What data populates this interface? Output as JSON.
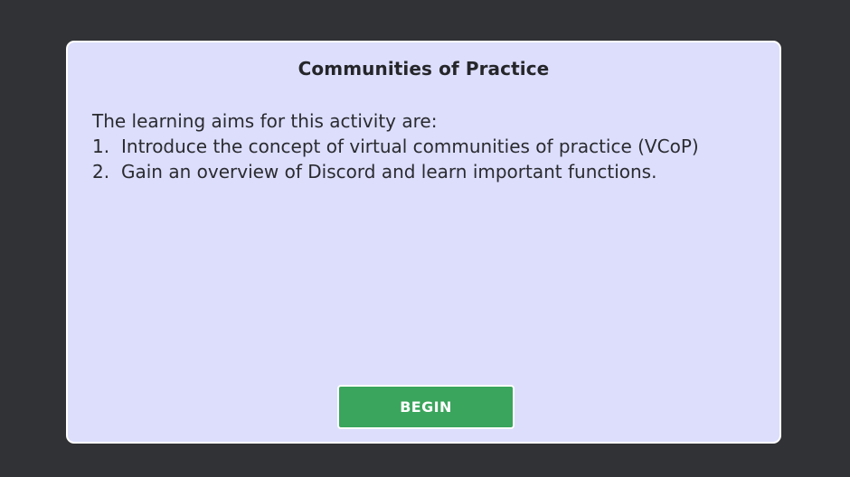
{
  "dialog": {
    "title": "Communities of Practice",
    "intro": "The learning aims for this activity are:",
    "aims": [
      {
        "number": "1.",
        "text": "Introduce the concept of virtual communities of practice (VCoP)"
      },
      {
        "number": "2.",
        "text": "Gain an overview of Discord and learn important functions."
      }
    ],
    "begin_label": "BEGIN"
  },
  "colors": {
    "background": "#313235",
    "dialog_fill": "#dcdefc",
    "dialog_border": "#ffffff",
    "button_fill": "#3aa55c",
    "button_text": "#ffffff",
    "text": "#2a2b30"
  }
}
